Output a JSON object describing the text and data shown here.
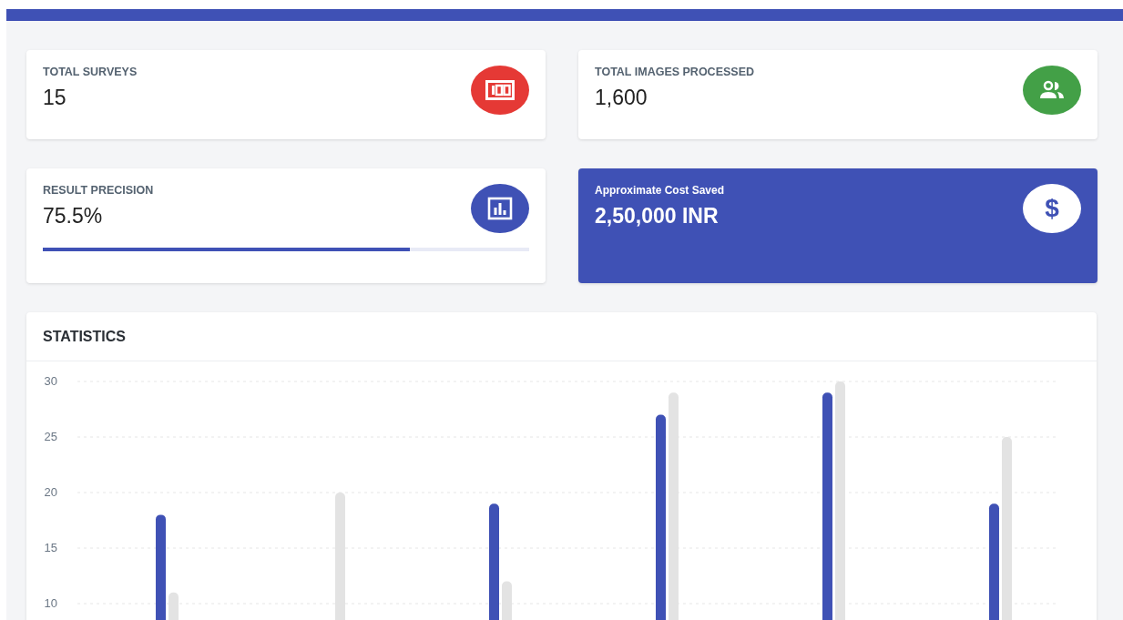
{
  "cards": [
    {
      "kind": "stat",
      "label": "TOTAL SURVEYS",
      "value": "15",
      "color": "#e53935"
    },
    {
      "kind": "stat",
      "label": "TOTAL IMAGES PROCESSED",
      "value": "1,600",
      "color": "#43a047"
    },
    {
      "kind": "progress",
      "label": "RESULT PRECISION",
      "value": "75.5%",
      "color": "#3f51b5",
      "level": 0.755
    },
    {
      "kind": "highlight",
      "label": "Approximate Cost Saved",
      "value": "2,50,000 INR",
      "icon_text": "$",
      "color": "#ffffff"
    }
  ],
  "statistics": {
    "title": "STATISTICS",
    "chart_data": {
      "type": "bar",
      "ylim": [
        7.7,
        30
      ],
      "yticks": [
        10,
        15,
        20,
        25,
        30
      ],
      "grid": true,
      "series": [
        {
          "color": "#3f51b5",
          "values": [
            18,
            null,
            19,
            27,
            29,
            19
          ]
        },
        {
          "color": "#e3e3e3",
          "values": [
            11,
            20,
            12,
            29,
            30,
            25
          ]
        }
      ]
    }
  }
}
